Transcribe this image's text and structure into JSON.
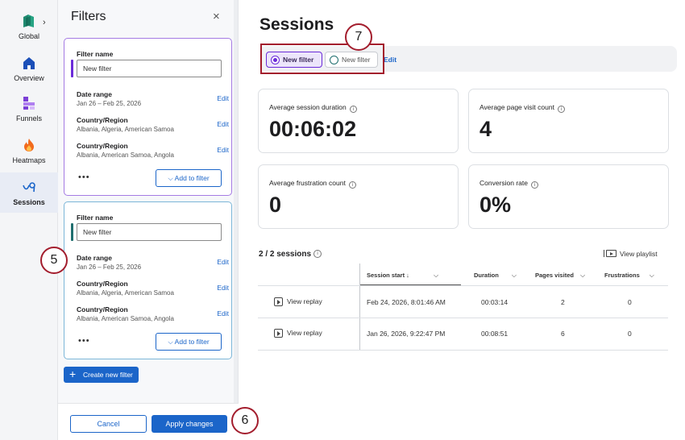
{
  "nav": {
    "items": [
      {
        "label": "Global",
        "icon": "global-logo-icon"
      },
      {
        "label": "Overview",
        "icon": "home-icon"
      },
      {
        "label": "Funnels",
        "icon": "funnel-icon"
      },
      {
        "label": "Heatmaps",
        "icon": "flame-icon"
      },
      {
        "label": "Sessions",
        "icon": "sessions-icon"
      }
    ],
    "chevron": "›"
  },
  "filters": {
    "title": "Filters",
    "close": "×",
    "cards": [
      {
        "name_label": "Filter name",
        "name_value": "New filter",
        "rows": [
          {
            "title": "Date range",
            "value": "Jan 26 – Feb 25, 2026",
            "edit": "Edit"
          },
          {
            "title": "Country/Region",
            "value": "Albania, Algeria, American Samoa",
            "edit": "Edit"
          },
          {
            "title": "Country/Region",
            "value": "Albania, American Samoa, Angola",
            "edit": "Edit"
          }
        ],
        "more": "•••",
        "add_button": "Add to filter"
      },
      {
        "name_label": "Filter name",
        "name_value": "New filter",
        "rows": [
          {
            "title": "Date range",
            "value": "Jan 26 – Feb 25, 2026",
            "edit": "Edit"
          },
          {
            "title": "Country/Region",
            "value": "Albania, Algeria, American Samoa",
            "edit": "Edit"
          },
          {
            "title": "Country/Region",
            "value": "Albania, American Samoa, Angola",
            "edit": "Edit"
          }
        ],
        "more": "•••",
        "add_button": "Add to filter"
      }
    ],
    "create_button": "Create new filter",
    "cancel_button": "Cancel",
    "apply_button": "Apply changes"
  },
  "main": {
    "title": "Sessions",
    "segments": [
      {
        "label": "New filter",
        "selected": true
      },
      {
        "label": "New filter",
        "selected": false
      }
    ],
    "segments_edit": "Edit",
    "metrics": [
      {
        "label": "Average session duration",
        "value": "00:06:02"
      },
      {
        "label": "Average page visit count",
        "value": "4"
      },
      {
        "label": "Average frustration count",
        "value": "0"
      },
      {
        "label": "Conversion rate",
        "value": "0%"
      }
    ],
    "sessions_count": "2 / 2 sessions",
    "view_playlist": "View playlist",
    "columns": [
      "Session start ↓",
      "Duration",
      "Pages visited",
      "Frustrations"
    ],
    "rows": [
      {
        "replay": "View replay",
        "start": "Feb 24, 2026, 8:01:46 AM",
        "duration": "00:03:14",
        "pages": "2",
        "frustrations": "0"
      },
      {
        "replay": "View replay",
        "start": "Jan 26, 2026, 9:22:47 PM",
        "duration": "00:08:51",
        "pages": "6",
        "frustrations": "0"
      }
    ]
  },
  "annotations": {
    "badge_5": "5",
    "badge_6": "6",
    "badge_7": "7"
  },
  "colors": {
    "accent_purple": "#6b2bd9",
    "accent_teal": "#1f6e6e",
    "link_blue": "#1b65c9",
    "highlight_red": "#a31d2d"
  }
}
